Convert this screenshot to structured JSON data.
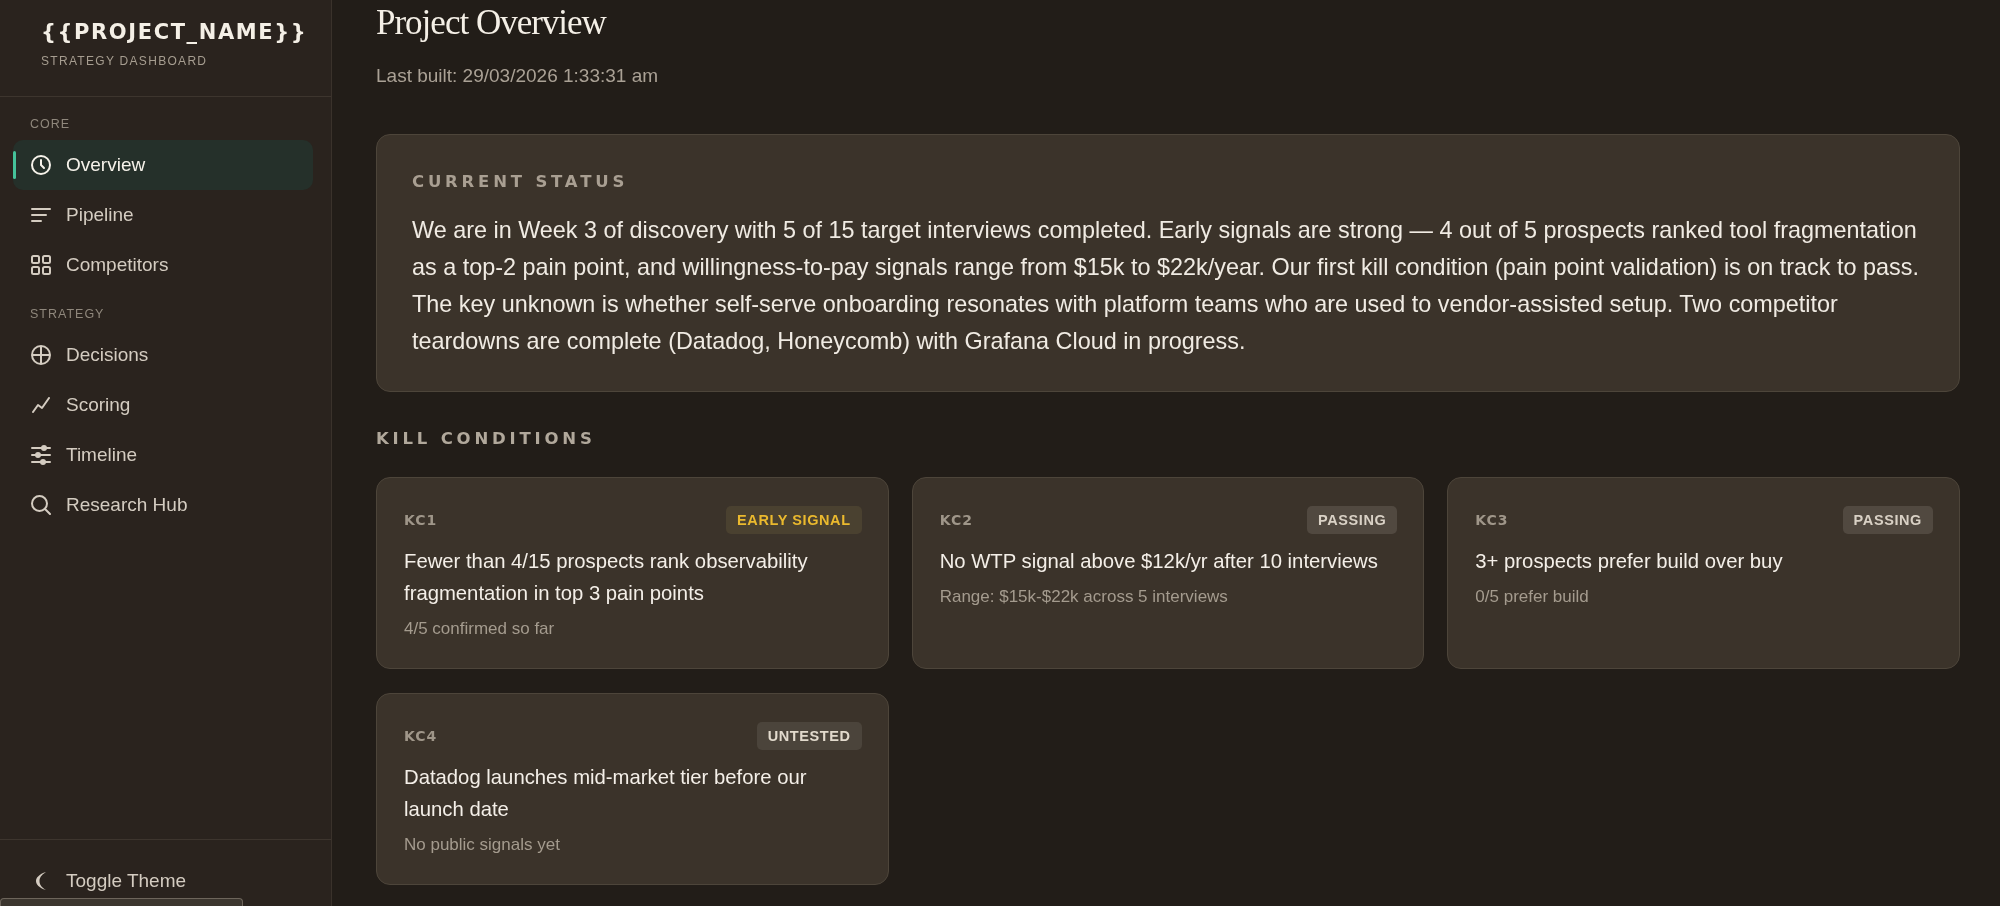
{
  "sidebar": {
    "logo": "{{PROJECT_NAME}}",
    "subtitle": "STRATEGY DASHBOARD",
    "sections": [
      {
        "label": "CORE",
        "items": [
          {
            "label": "Overview",
            "selected": true
          },
          {
            "label": "Pipeline",
            "selected": false
          },
          {
            "label": "Competitors",
            "selected": false
          }
        ]
      },
      {
        "label": "STRATEGY",
        "items": [
          {
            "label": "Decisions",
            "selected": false
          },
          {
            "label": "Scoring",
            "selected": false
          },
          {
            "label": "Timeline",
            "selected": false
          },
          {
            "label": "Research Hub",
            "selected": false
          }
        ]
      }
    ],
    "theme_toggle": "Toggle Theme"
  },
  "header": {
    "title": "Project Overview",
    "last_built": "Last built: 29/03/2026 1:33:31 am"
  },
  "current_status": {
    "heading": "CURRENT STATUS",
    "text": "We are in Week 3 of discovery with 5 of 15 target interviews completed. Early signals are strong — 4 out of 5 prospects ranked tool fragmentation as a top-2 pain point, and willingness-to-pay signals range from $15k to $22k/year. Our first kill condition (pain point validation) is on track to pass. The key unknown is whether self-serve onboarding resonates with platform teams who are used to vendor-assisted setup. Two competitor teardowns are complete (Datadog, Honeycomb) with Grafana Cloud in progress."
  },
  "kill_conditions": {
    "heading": "KILL CONDITIONS",
    "items": [
      {
        "code": "KC1",
        "status": "EARLY SIGNAL",
        "kind": "early",
        "title": "Fewer than 4/15 prospects rank observability fragmentation in top 3 pain points",
        "note": "4/5 confirmed so far"
      },
      {
        "code": "KC2",
        "status": "PASSING",
        "kind": "passing",
        "title": "No WTP signal above $12k/yr after 10 interviews",
        "note": "Range: $15k-$22k across 5 interviews"
      },
      {
        "code": "KC3",
        "status": "PASSING",
        "kind": "passing",
        "title": "3+ prospects prefer build over buy",
        "note": "0/5 prefer build"
      },
      {
        "code": "KC4",
        "status": "UNTESTED",
        "kind": "untested",
        "title": "Datadog launches mid-market tier before our launch date",
        "note": "No public signals yet"
      }
    ]
  }
}
